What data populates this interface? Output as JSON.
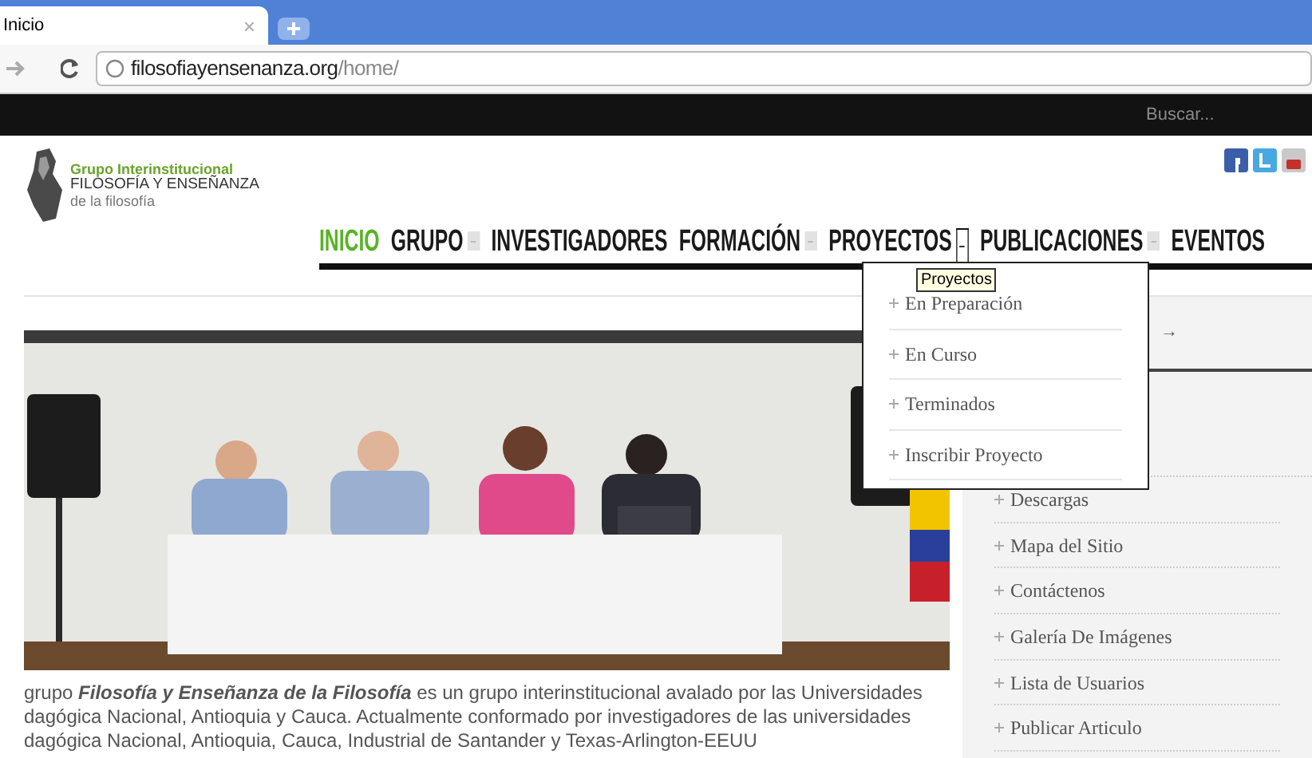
{
  "browser": {
    "tab": {
      "title": "Inicio",
      "close": "×"
    },
    "address": {
      "host": "filosofiayensenanza.org",
      "path": "/home/"
    }
  },
  "top_bar": {
    "search": {
      "placeholder": "Buscar..."
    }
  },
  "logo": {
    "line_1": "Grupo Interinstitucional",
    "line_2": "FILOSOFÍA Y ENSEÑANZA",
    "line_3": "de la filosofía"
  },
  "nav": [
    {
      "label": "INICIO",
      "selected": true,
      "submenu": false
    },
    {
      "label": "GRUPO",
      "selected": false,
      "submenu": true,
      "open": false
    },
    {
      "label": "INVESTIGADORES",
      "selected": false,
      "submenu": false
    },
    {
      "label": "FORMACIÓN",
      "selected": false,
      "submenu": true,
      "open": false
    },
    {
      "label": "PROYECTOS",
      "selected": false,
      "submenu": true,
      "open": true
    },
    {
      "label": "PUBLICACIONES",
      "selected": false,
      "submenu": true,
      "open": false
    },
    {
      "label": "EVENTOS",
      "selected": false,
      "submenu": false
    }
  ],
  "tooltip": "Proyectos",
  "dropdown": [
    "En Preparación",
    "En Curso",
    "Terminados",
    "Inscribir Proyecto"
  ],
  "paragraph": "grupo **Filosofía y Enseñanza de la Filosofía** es un grupo interinstitucional avalado por las Universidades\ndagógica Nacional, Antioquia y Cauca. Actualmente conformado por investigadores de las universidades\ndagógica Nacional, Antioquia, Cauca, Industrial de Santander y Texas-Arlington-EEUU",
  "sidebar": {
    "arrow": "→",
    "items": [
      "Descargas",
      "Mapa del Sitio",
      "Contáctenos",
      "Galería De Imágenes",
      "Lista de Usuarios",
      "Publicar Articulo"
    ]
  }
}
